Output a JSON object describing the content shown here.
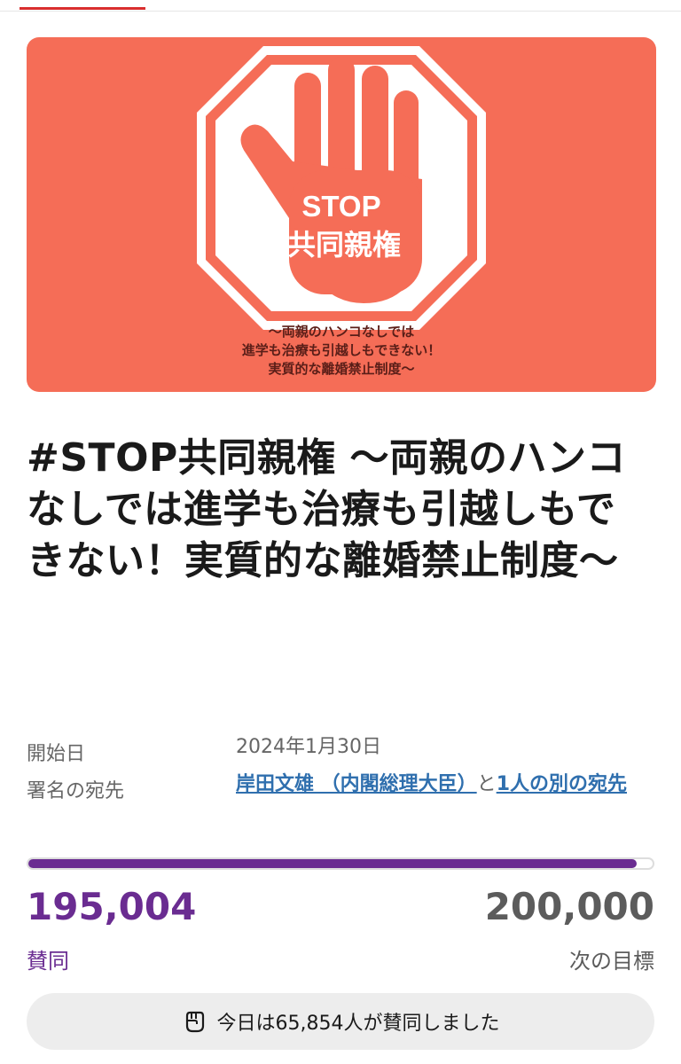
{
  "hero": {
    "stop_text": "STOP",
    "sign_text": "共同親権",
    "caption_lines": [
      "〜両親のハンコなしでは",
      "進学も治療も引越しもできない！",
      "実質的な離婚禁止制度〜"
    ],
    "background_color": "#f56d57"
  },
  "petition": {
    "title": "#STOP共同親権 〜両親のハンコなしでは進学も治療も引越しもできない！実質的な離婚禁止制度〜"
  },
  "meta": {
    "start_label": "開始日",
    "start_value": "2024年1月30日",
    "recipient_label": "署名の宛先",
    "recipient_link": "岸田文雄 （内閣総理大臣）",
    "recipient_connector": "と",
    "other_recipient_link": "1人の別の宛先"
  },
  "progress": {
    "signatures": "195,004",
    "signatures_label": "賛同",
    "goal": "200,000",
    "goal_label": "次の目標",
    "fill_fraction": 0.975,
    "accent_color": "#6a2c91"
  },
  "today": {
    "icon": "fist-icon",
    "text": "今日は65,854人が賛同しました"
  }
}
